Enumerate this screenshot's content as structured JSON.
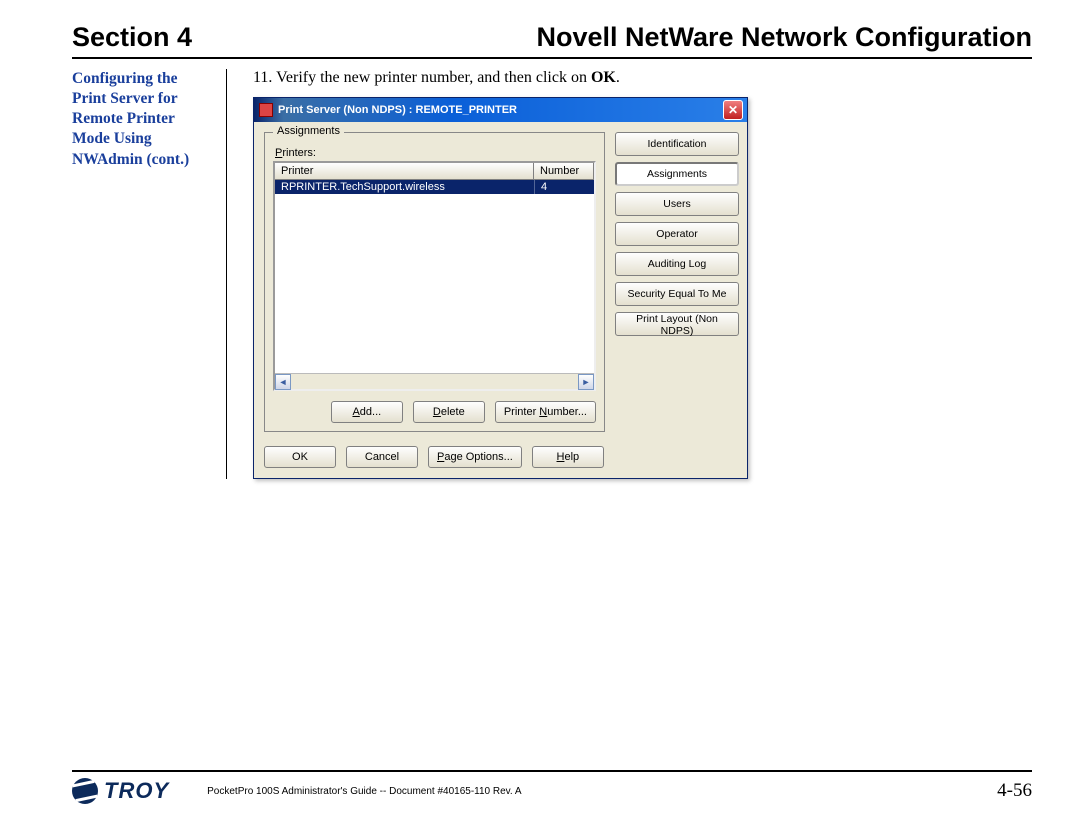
{
  "header": {
    "section_label": "Section 4",
    "chapter_title": "Novell NetWare Network Configuration"
  },
  "sidebar": {
    "heading": "Configuring the Print Server for Remote Printer Mode Using NWAdmin (cont.)"
  },
  "step": {
    "number": "11.",
    "prefix": "Verify the new printer number, and then click on ",
    "bold": "OK",
    "suffix": "."
  },
  "dialog": {
    "title": "Print Server (Non NDPS) : REMOTE_PRINTER",
    "group_label": "Assignments",
    "list_label_u": "P",
    "list_label_rest": "rinters:",
    "columns": {
      "printer": "Printer",
      "number": "Number"
    },
    "rows": [
      {
        "printer": "RPRINTER.TechSupport.wireless",
        "number": "4"
      }
    ],
    "row_buttons": {
      "add_u": "A",
      "add_rest": "dd...",
      "delete_u": "D",
      "delete_rest": "elete",
      "pn_pre": "Printer ",
      "pn_u": "N",
      "pn_rest": "umber..."
    },
    "bottom_buttons": {
      "ok": "OK",
      "cancel": "Cancel",
      "page_pre": "",
      "page_u": "P",
      "page_rest": "age Options...",
      "help_u": "H",
      "help_rest": "elp"
    },
    "tabs": [
      "Identification",
      "Assignments",
      "Users",
      "Operator",
      "Auditing Log",
      "Security Equal To Me",
      "Print Layout (Non NDPS)"
    ],
    "tab_selected_index": 1
  },
  "footer": {
    "logo_text": "TROY",
    "doc_info": "PocketPro 100S Administrator's Guide -- Document #40165-110  Rev. A",
    "page_number": "4-56"
  }
}
